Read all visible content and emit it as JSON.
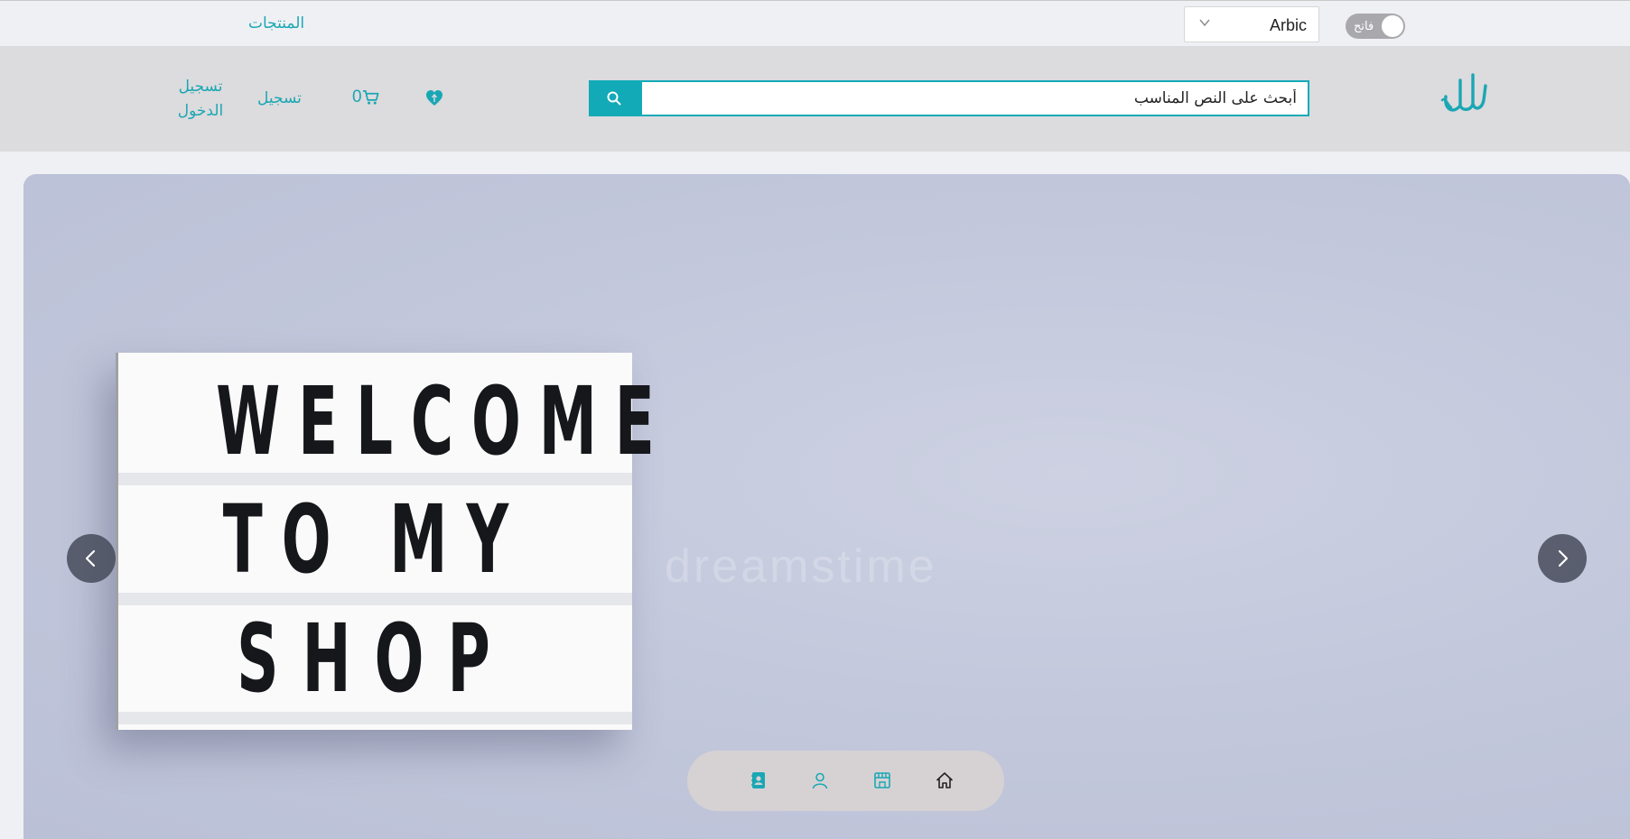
{
  "topbar": {
    "products_label": "المنتجات",
    "language": "Arbic",
    "theme_label": "فاتح"
  },
  "header": {
    "search_value": "أبحث على النص المناسب",
    "cart_count": "0",
    "register_label": "تسجيل",
    "login_label": "تسجيل الدخول"
  },
  "hero": {
    "lightbox_lines": [
      "WELCOME",
      "TO MY",
      "SHOP"
    ],
    "watermark": "dreamstime"
  },
  "colors": {
    "accent": "#12aab7",
    "link": "#1aa7b4",
    "header_bg": "#dcdbdd",
    "page_bg": "#eff0f3"
  },
  "icons": {
    "search": "search-icon",
    "cart": "cart-icon",
    "wishlist": "heart-icon",
    "prev": "chevron-left-icon",
    "next": "chevron-right-icon",
    "bottom_nav": [
      "contacts-icon",
      "user-icon",
      "store-icon",
      "home-icon"
    ]
  }
}
